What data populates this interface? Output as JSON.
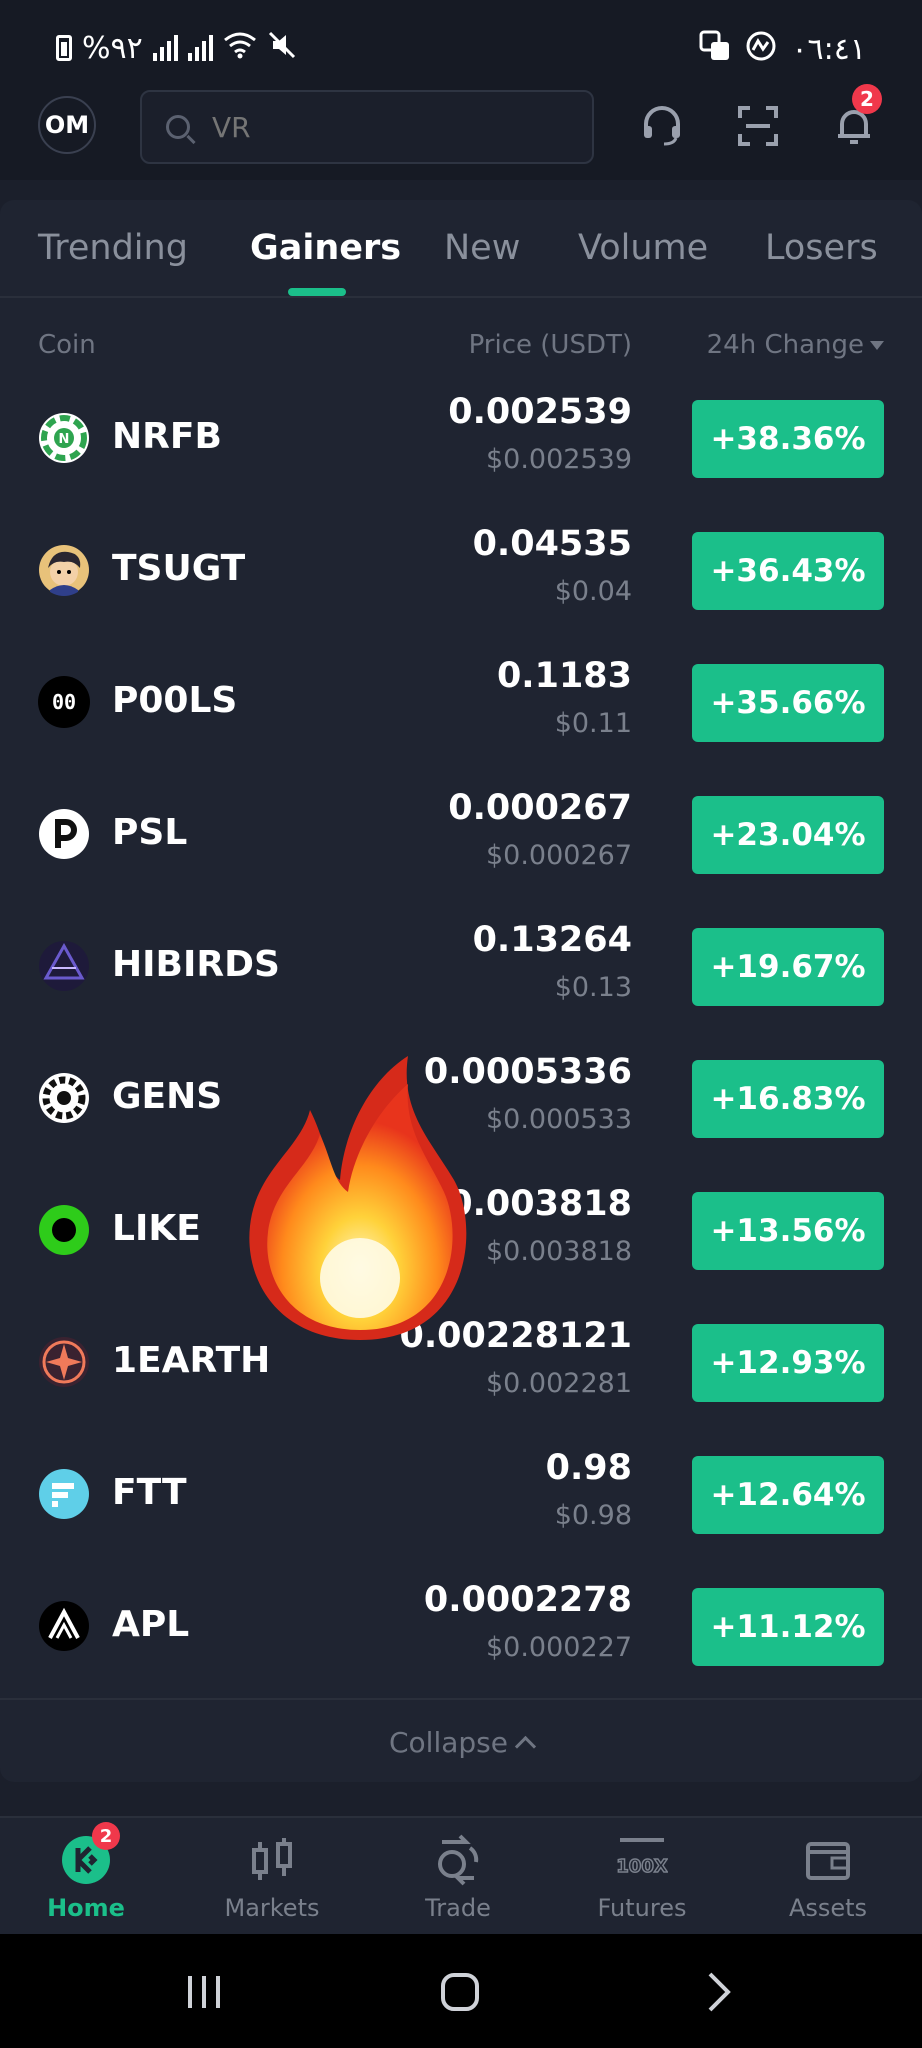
{
  "status_bar": {
    "battery_percent": "%٩٢",
    "time": "٠٦:٤١"
  },
  "header": {
    "avatar_initials": "OM",
    "search_placeholder": "VR",
    "notification_count": "2"
  },
  "tabs": [
    {
      "label": "Trending",
      "active": false
    },
    {
      "label": "Gainers",
      "active": true
    },
    {
      "label": "New",
      "active": false
    },
    {
      "label": "Volume",
      "active": false
    },
    {
      "label": "Losers",
      "active": false
    }
  ],
  "columns": {
    "coin": "Coin",
    "price": "Price (USDT)",
    "change": "24h Change"
  },
  "rows": [
    {
      "symbol": "NRFB",
      "price": "0.002539",
      "price_usd": "$0.002539",
      "change": "+38.36%",
      "logo": "nrfb-logo"
    },
    {
      "symbol": "TSUGT",
      "price": "0.04535",
      "price_usd": "$0.04",
      "change": "+36.43%",
      "logo": "tsugt-logo"
    },
    {
      "symbol": "P00LS",
      "price": "0.1183",
      "price_usd": "$0.11",
      "change": "+35.66%",
      "logo": "p00ls-logo"
    },
    {
      "symbol": "PSL",
      "price": "0.000267",
      "price_usd": "$0.000267",
      "change": "+23.04%",
      "logo": "psl-logo"
    },
    {
      "symbol": "HIBIRDS",
      "price": "0.13264",
      "price_usd": "$0.13",
      "change": "+19.67%",
      "logo": "hibirds-logo"
    },
    {
      "symbol": "GENS",
      "price": "0.0005336",
      "price_usd": "$0.000533",
      "change": "+16.83%",
      "logo": "gens-logo"
    },
    {
      "symbol": "LIKE",
      "price": "0.003818",
      "price_usd": "$0.003818",
      "change": "+13.56%",
      "logo": "like-logo"
    },
    {
      "symbol": "1EARTH",
      "price": "0.00228121",
      "price_usd": "$0.002281",
      "change": "+12.93%",
      "logo": "1earth-logo"
    },
    {
      "symbol": "FTT",
      "price": "0.98",
      "price_usd": "$0.98",
      "change": "+12.64%",
      "logo": "ftt-logo"
    },
    {
      "symbol": "APL",
      "price": "0.0002278",
      "price_usd": "$0.000227",
      "change": "+11.12%",
      "logo": "apl-logo"
    }
  ],
  "collapse_label": "Collapse",
  "bottom_nav": [
    {
      "label": "Home",
      "active": true,
      "badge": "2",
      "icon": "home-icon"
    },
    {
      "label": "Markets",
      "active": false,
      "icon": "markets-icon"
    },
    {
      "label": "Trade",
      "active": false,
      "icon": "trade-icon"
    },
    {
      "label": "Futures",
      "active": false,
      "icon": "futures-icon",
      "icon_text": "100X"
    },
    {
      "label": "Assets",
      "active": false,
      "icon": "assets-icon"
    }
  ],
  "colors": {
    "accent_green": "#1bbf8a",
    "background": "#1b1f2b",
    "badge_red": "#f0384b"
  }
}
